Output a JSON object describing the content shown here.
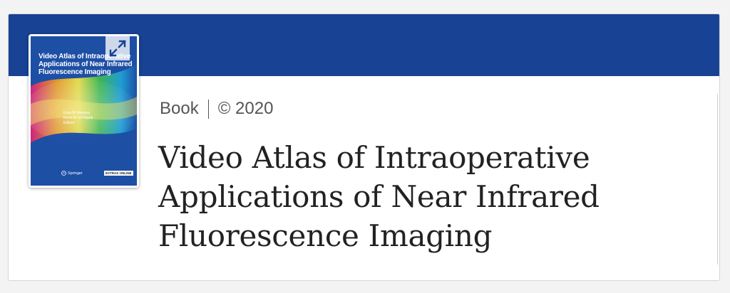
{
  "book": {
    "type_label": "Book",
    "copyright": "© 2020",
    "title": "Video Atlas of Intraoperative Applications of Near Infrared Fluorescence Imaging"
  },
  "cover": {
    "title": "Video Atlas of Intraoperative Applications of Near Infrared Fluorescence Imaging",
    "editors": [
      "Essa M. Aleassa",
      "Kevin M. El-Hayek",
      "Editors"
    ],
    "publisher": "Springer",
    "badge": "EXTRAS ONLINE",
    "expand_icon": "expand-arrows-icon"
  },
  "colors": {
    "banner": "#184294",
    "cover_bg": "#1d4fa5",
    "page_bg": "#f3f3f3",
    "meta_text": "#555555",
    "title_text": "#222222"
  }
}
